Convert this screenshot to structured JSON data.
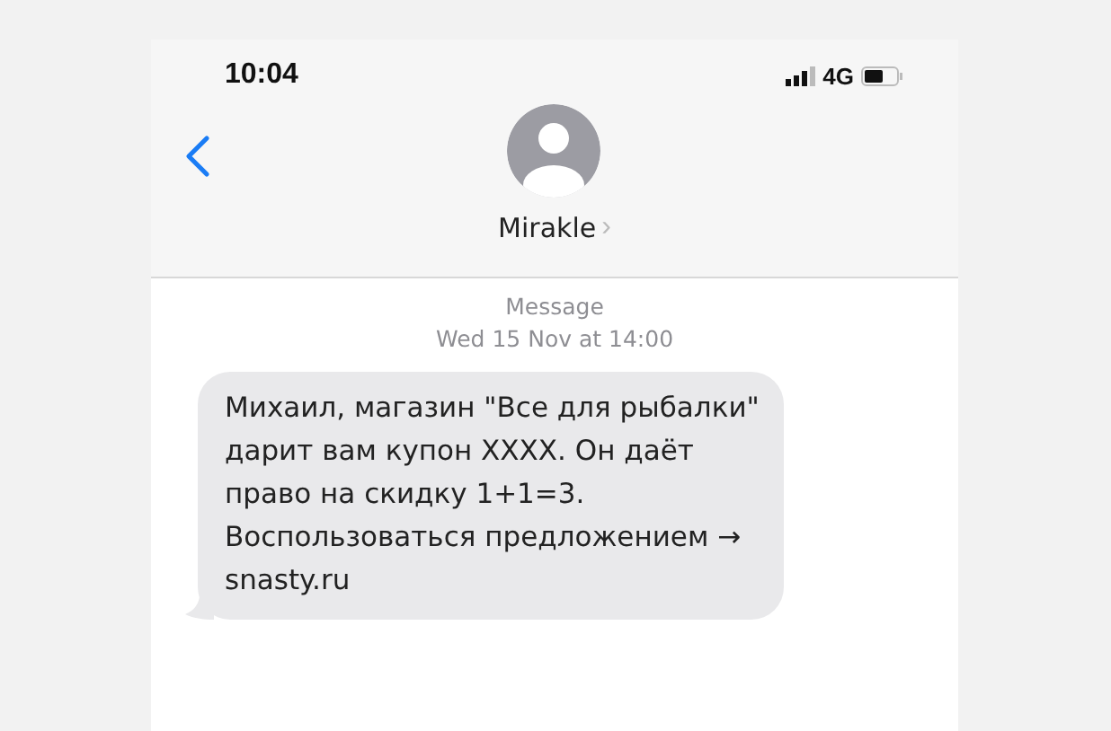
{
  "status_bar": {
    "time": "10:04",
    "network": "4G"
  },
  "header": {
    "contact_name": "Mirakle",
    "chevron": "›"
  },
  "thread": {
    "service_label": "Message",
    "timestamp": "Wed 15 Nov at 14:00",
    "messages": [
      {
        "kind": "incoming",
        "text": "Михаил, магазин \"Все для рыбалки\"\nдарит вам купон ХХХХ. Он даёт\nправо на скидку 1+1=3.\nВоспользоваться предложением →\nsnasty.ru"
      }
    ]
  }
}
